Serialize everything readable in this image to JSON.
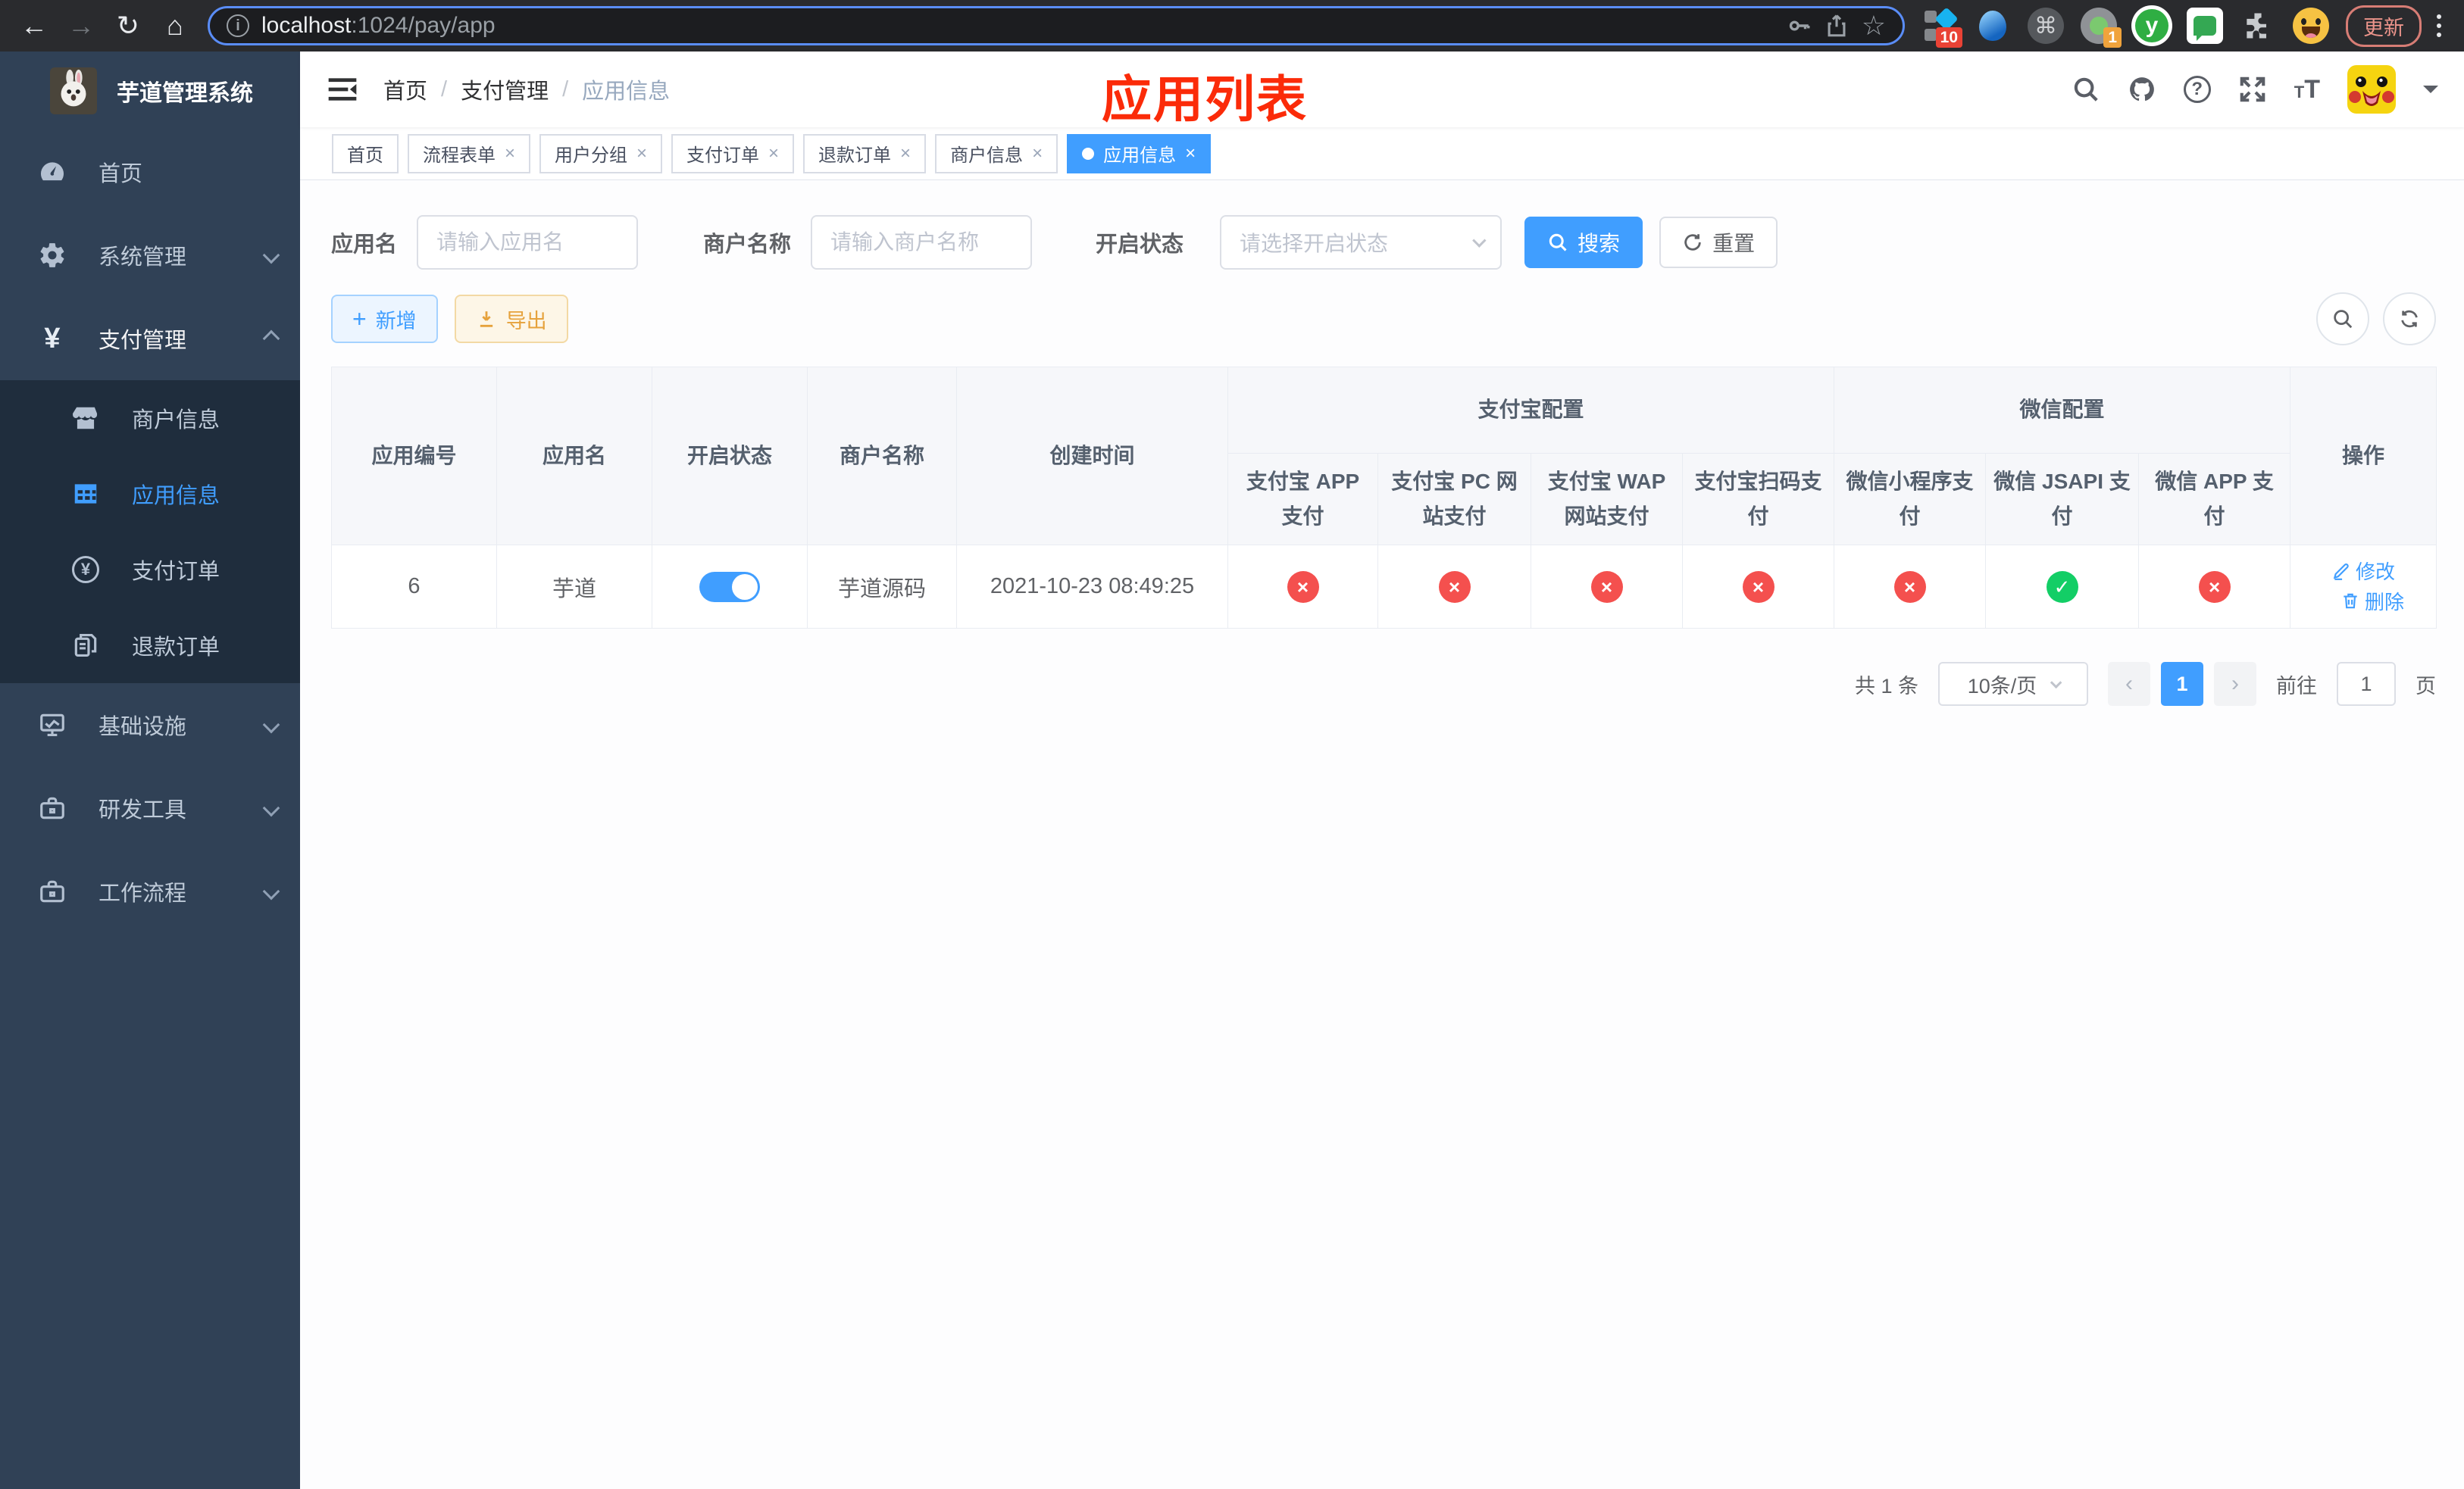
{
  "browser": {
    "url_host": "localhost",
    "url_rest": ":1024/pay/app",
    "ext_badge_a": "10",
    "ext_badge_b": "1",
    "update_label": "更新"
  },
  "sidebar": {
    "title": "芋道管理系统",
    "items": [
      {
        "label": "首页"
      },
      {
        "label": "系统管理"
      },
      {
        "label": "支付管理"
      },
      {
        "label": "基础设施"
      },
      {
        "label": "研发工具"
      },
      {
        "label": "工作流程"
      }
    ],
    "payment_children": [
      {
        "label": "商户信息"
      },
      {
        "label": "应用信息"
      },
      {
        "label": "支付订单"
      },
      {
        "label": "退款订单"
      }
    ]
  },
  "navbar": {
    "breadcrumb": [
      "首页",
      "支付管理",
      "应用信息"
    ],
    "separator": "/",
    "overlay_title": "应用列表"
  },
  "tags": [
    {
      "label": "首页"
    },
    {
      "label": "流程表单"
    },
    {
      "label": "用户分组"
    },
    {
      "label": "支付订单"
    },
    {
      "label": "退款订单"
    },
    {
      "label": "商户信息"
    },
    {
      "label": "应用信息"
    }
  ],
  "filter": {
    "app_name_label": "应用名",
    "app_name_placeholder": "请输入应用名",
    "merchant_label": "商户名称",
    "merchant_placeholder": "请输入商户名称",
    "status_label": "开启状态",
    "status_placeholder": "请选择开启状态",
    "search_label": "搜索",
    "reset_label": "重置"
  },
  "toolbar": {
    "add_label": "新增",
    "export_label": "导出"
  },
  "table": {
    "headers": {
      "app_id": "应用编号",
      "app_name": "应用名",
      "status": "开启状态",
      "merchant": "商户名称",
      "created": "创建时间",
      "alipay_group": "支付宝配置",
      "wechat_group": "微信配置",
      "actions": "操作",
      "pay_columns": [
        "支付宝 APP 支付",
        "支付宝 PC 网站支付",
        "支付宝 WAP 网站支付",
        "支付宝扫码支付",
        "微信小程序支付",
        "微信 JSAPI 支付",
        "微信 APP 支付"
      ]
    },
    "row": {
      "app_id": "6",
      "app_name": "芋道",
      "enabled": true,
      "merchant": "芋道源码",
      "created": "2021-10-23 08:49:25",
      "pay_status": [
        false,
        false,
        false,
        false,
        false,
        true,
        false
      ],
      "edit_label": "修改",
      "delete_label": "删除"
    }
  },
  "pagination": {
    "total": "共 1 条",
    "page_size": "10条/页",
    "current_page": "1",
    "goto_prefix": "前往",
    "goto_value": "1",
    "goto_suffix": "页"
  },
  "colors": {
    "primary": "#409EFF",
    "success": "#13ce66",
    "danger": "#f4504e",
    "warning": "#e6a23c",
    "sidebar_bg": "#304156",
    "sidebar_sub_bg": "#1f2d3d",
    "annotation_red": "#fb2b09"
  }
}
